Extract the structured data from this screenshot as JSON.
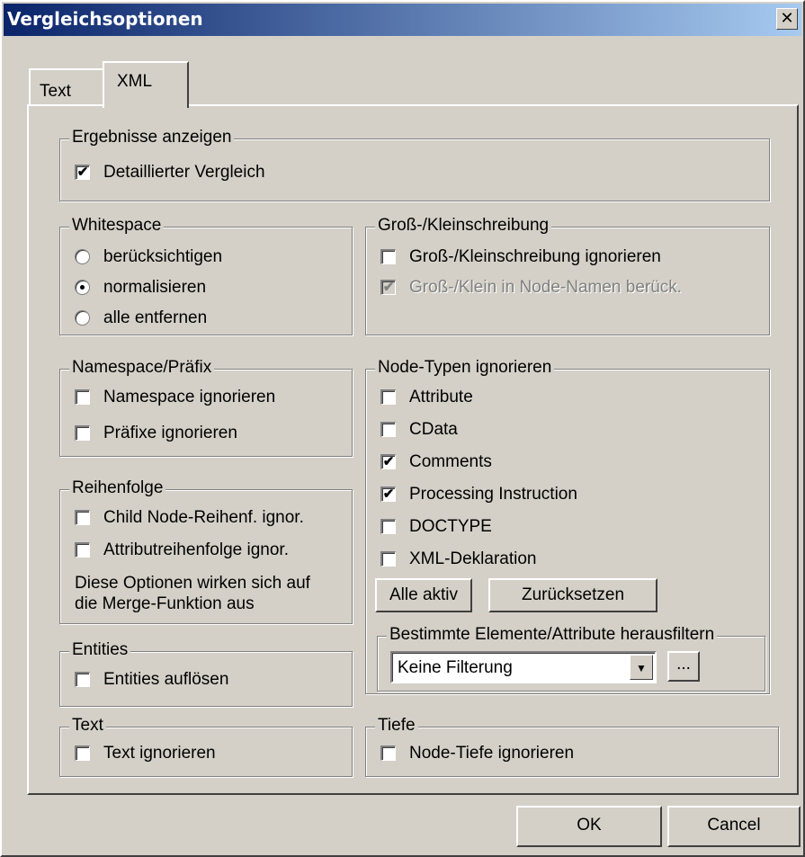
{
  "window": {
    "title": "Vergleichsoptionen",
    "close_glyph": "✕"
  },
  "tabs": [
    {
      "label": "Text",
      "active": false
    },
    {
      "label": "XML",
      "active": true
    }
  ],
  "groups": {
    "results": {
      "label": "Ergebnisse anzeigen",
      "detailed": {
        "label": "Detaillierter Vergleich",
        "checked": true
      }
    },
    "whitespace": {
      "label": "Whitespace",
      "options": [
        "berücksichtigen",
        "normalisieren",
        "alle entfernen"
      ],
      "selected": "normalisieren"
    },
    "case": {
      "label": "Groß-/Kleinschreibung",
      "ignore": {
        "label": "Groß-/Kleinschreibung ignorieren",
        "checked": false
      },
      "node_names": {
        "label": "Groß-/Klein in Node-Namen berück.",
        "checked": true,
        "disabled": true
      }
    },
    "namespace": {
      "label": "Namespace/Präfix",
      "ignore_namespace": {
        "label": "Namespace ignorieren",
        "checked": false
      },
      "ignore_prefix": {
        "label": "Präfixe ignorieren",
        "checked": false
      }
    },
    "node_types": {
      "label": "Node-Typen ignorieren",
      "items": [
        {
          "label": "Attribute",
          "checked": false
        },
        {
          "label": "CData",
          "checked": false
        },
        {
          "label": "Comments",
          "checked": true
        },
        {
          "label": "Processing Instruction",
          "checked": true
        },
        {
          "label": "DOCTYPE",
          "checked": false
        },
        {
          "label": "XML-Deklaration",
          "checked": false
        }
      ],
      "all_active_button": "Alle aktiv",
      "reset_button": "Zurücksetzen",
      "filter": {
        "label": "Bestimmte Elemente/Attribute herausfiltern",
        "selected": "Keine Filterung",
        "browse_button": "..."
      }
    },
    "order": {
      "label": "Reihenfolge",
      "child_order": {
        "label": "Child Node-Reihenf. ignor.",
        "checked": false
      },
      "attr_order": {
        "label": "Attributreihenfolge ignor.",
        "checked": false
      },
      "note_line1": "Diese Optionen wirken sich auf",
      "note_line2": "die Merge-Funktion aus"
    },
    "entities": {
      "label": "Entities",
      "resolve": {
        "label": "Entities auflösen",
        "checked": false
      }
    },
    "text": {
      "label": "Text",
      "ignore": {
        "label": "Text ignorieren",
        "checked": false
      }
    },
    "depth": {
      "label": "Tiefe",
      "ignore": {
        "label": "Node-Tiefe ignorieren",
        "checked": false
      }
    }
  },
  "buttons": {
    "ok": "OK",
    "cancel": "Cancel"
  },
  "glyphs": {
    "check": "✔",
    "dropdown_arrow": "▼"
  }
}
